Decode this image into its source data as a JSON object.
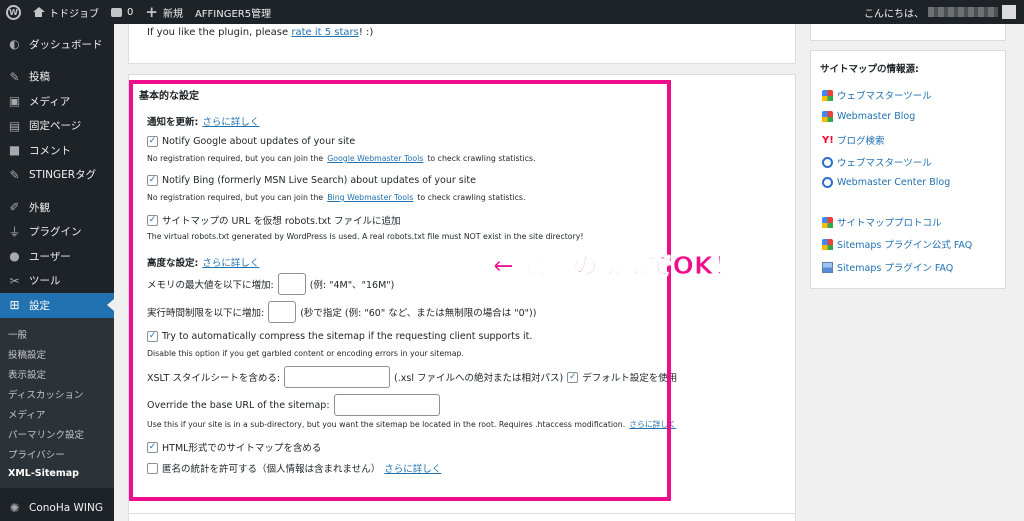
{
  "adminbar": {
    "site_name": "トドジョブ",
    "comments_count": "0",
    "new_label": "新規",
    "affinger_label": "AFFINGER5管理",
    "greeting": "こんにちは、"
  },
  "menu": {
    "items": [
      {
        "label": "ダッシュボード",
        "icon": "dashboard-icon"
      },
      {
        "label": "投稿",
        "icon": "pin-icon"
      },
      {
        "label": "メディア",
        "icon": "media-icon"
      },
      {
        "label": "固定ページ",
        "icon": "page-icon"
      },
      {
        "label": "コメント",
        "icon": "comment-icon"
      },
      {
        "label": "STINGERタグ",
        "icon": "pin-icon"
      },
      {
        "label": "外観",
        "icon": "brush-icon"
      },
      {
        "label": "プラグイン",
        "icon": "plugin-icon"
      },
      {
        "label": "ユーザー",
        "icon": "user-icon"
      },
      {
        "label": "ツール",
        "icon": "wrench-icon"
      },
      {
        "label": "設定",
        "icon": "settings-icon"
      }
    ],
    "submenu": [
      "一般",
      "投稿設定",
      "表示設定",
      "ディスカッション",
      "メディア",
      "パーマリンク設定",
      "プライバシー",
      "XML-Sitemap"
    ],
    "bottom_label": "ConoHa WING"
  },
  "top_panel": {
    "text_before": "If you like the plugin, please ",
    "link": "rate it 5 stars",
    "text_after": "! :)"
  },
  "settings": {
    "box_title": "基本的な設定",
    "notify_heading": "通知を更新:",
    "notify_more": "さらに詳しく",
    "google_label": "Notify Google about updates of your site",
    "google_desc_before": "No registration required, but you can join the ",
    "google_desc_link": "Google Webmaster Tools",
    "google_desc_after": " to check crawling statistics.",
    "bing_label": "Notify Bing (formerly MSN Live Search) about updates of your site",
    "bing_desc_before": "No registration required, but you can join the ",
    "bing_desc_link": "Bing Webmaster Tools",
    "bing_desc_after": " to check crawling statistics.",
    "robots_label": "サイトマップの URL を仮想 robots.txt ファイルに追加",
    "robots_desc": "The virtual robots.txt generated by WordPress is used. A real robots.txt file must NOT exist in the site directory!",
    "advanced_heading": "高度な設定:",
    "advanced_more": "さらに詳しく",
    "memory_label": "メモリの最大値を以下に増加:",
    "memory_hint": "(例: \"4M\"、\"16M\")",
    "exec_label": "実行時間制限を以下に増加:",
    "exec_hint": "(秒で指定 (例: \"60\" など、または無制限の場合は \"0\"))",
    "compress_label": "Try to automatically compress the sitemap if the requesting client supports it.",
    "compress_desc": "Disable this option if you get garbled content or encoding errors in your sitemap.",
    "xslt_label": "XSLT スタイルシートを含める:",
    "xslt_hint": "(.xsl ファイルへの絶対または相対パス)",
    "default_label": "デフォルト設定を使用",
    "base_url_label": "Override the base URL of the sitemap:",
    "base_url_desc": "Use this if your site is in a sub-directory, but you want the sitemap be located in the root. Requires .htaccess modification.",
    "base_url_more": "さらに詳しく",
    "html_label": "HTML形式でのサイトマップを含める",
    "anon_label": "匿名の統計を許可する（個人情報は含まれません）",
    "anon_more": "さらに詳しく"
  },
  "annotation": "← 初期のままでOK！",
  "sidebar": {
    "title": "サイトマップの情報源:",
    "links": [
      {
        "label": "ウェブマスターツール",
        "icon": "google-icon"
      },
      {
        "label": "Webmaster Blog",
        "icon": "google-icon"
      },
      {
        "label": "ブログ検索",
        "icon": "yahoo-icon"
      },
      {
        "label": "ウェブマスターツール",
        "icon": "bing-icon"
      },
      {
        "label": "Webmaster Center Blog",
        "icon": "bing-icon"
      },
      {
        "label": "サイトマッププロトコル",
        "icon": "google-icon"
      },
      {
        "label": "Sitemaps プラグイン公式 FAQ",
        "icon": "google-icon"
      },
      {
        "label": "Sitemaps プラグイン FAQ",
        "icon": "sitemaps-icon"
      }
    ]
  },
  "colors": {
    "highlight": "#ef0c8d",
    "admin_dark": "#1d2327",
    "menu_current": "#2271b1",
    "link": "#2271b1"
  }
}
